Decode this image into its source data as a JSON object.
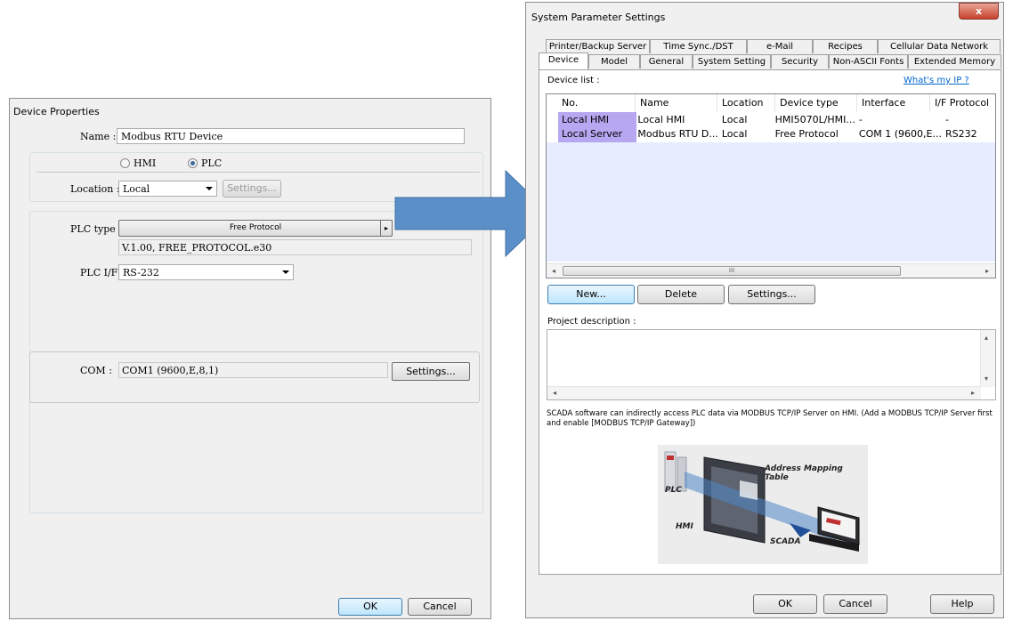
{
  "device_properties": {
    "title": "Device Properties",
    "name_label": "Name :",
    "name_value": "Modbus RTU Device",
    "radio_hmi": "HMI",
    "radio_plc": "PLC",
    "location_label": "Location :",
    "location_value": "Local",
    "location_settings": "Settings...",
    "plc_type_label": "PLC type :",
    "plc_type_value": "Free Protocol",
    "plc_version": "V.1.00, FREE_PROTOCOL.e30",
    "plc_if_label": "PLC I/F :",
    "plc_if_value": "RS-232",
    "com_label": "COM :",
    "com_value": "COM1 (9600,E,8,1)",
    "com_settings": "Settings...",
    "ok": "OK",
    "cancel": "Cancel"
  },
  "system_params": {
    "title": "System Parameter Settings",
    "close": "x",
    "tabs_row1": [
      "Printer/Backup Server",
      "Time Sync./DST",
      "e-Mail",
      "Recipes",
      "Cellular Data Network"
    ],
    "tabs_row2": [
      "Device",
      "Model",
      "General",
      "System Setting",
      "Security",
      "Non-ASCII Fonts",
      "Extended Memory"
    ],
    "device_list_label": "Device list :",
    "whats_my_ip": "What's my IP ?",
    "columns": [
      "No.",
      "Name",
      "Location",
      "Device type",
      "Interface",
      "I/F Protocol"
    ],
    "rows": [
      [
        "Local HMI",
        "Local HMI",
        "Local",
        "HMI5070L/HMI...",
        "-",
        "-"
      ],
      [
        "Local Server",
        "Modbus RTU D...",
        "Local",
        "Free Protocol",
        "COM 1 (9600,E...",
        "RS232"
      ]
    ],
    "scroll_mark": "III",
    "new_btn": "New...",
    "delete_btn": "Delete",
    "settings_btn": "Settings...",
    "project_desc_label": "Project description :",
    "scada_note": "SCADA software can indirectly access PLC data via MODBUS TCP/IP Server on HMI. (Add a MODBUS TCP/IP Server first and enable [MODBUS TCP/IP Gateway])",
    "diagram": {
      "address_mapping": "Address Mapping Table",
      "plc": "PLC",
      "hmi": "HMI",
      "scada": "SCADA"
    },
    "ok": "OK",
    "cancel": "Cancel",
    "help": "Help"
  },
  "colors": {
    "arrow": "#5b8fc8",
    "row_highlight": "#b7a6f0",
    "link": "#0066cc"
  }
}
